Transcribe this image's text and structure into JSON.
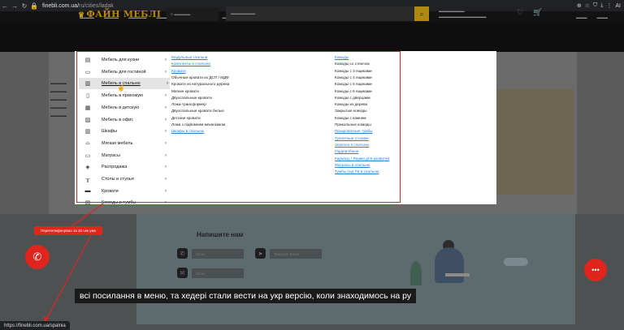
{
  "browser": {
    "url_host": "finebli.com.ua/",
    "url_path": "ru/cities/ladak",
    "right_label": "AI"
  },
  "mega_menu": {
    "categories": [
      {
        "label": "Мебель для кухни",
        "icon": "kitchen-icon"
      },
      {
        "label": "Мебель для гостиной",
        "icon": "living-room-icon"
      },
      {
        "label": "Мебель в спальню",
        "icon": "bedroom-icon"
      },
      {
        "label": "Мебель в прихожую",
        "icon": "hallway-icon"
      },
      {
        "label": "Мебель в детскую",
        "icon": "kids-room-icon"
      },
      {
        "label": "Мебель в офис",
        "icon": "office-icon"
      },
      {
        "label": "Шкафы",
        "icon": "wardrobe-icon"
      },
      {
        "label": "Мягкая мебель",
        "icon": "sofa-icon"
      },
      {
        "label": "Матрасы",
        "icon": "mattress-icon"
      },
      {
        "label": "Распродажа",
        "icon": "sale-icon"
      },
      {
        "label": "Столы и стулья",
        "icon": "table-icon"
      },
      {
        "label": "Кровати",
        "icon": "bed-icon"
      },
      {
        "label": "Комоды и тумбы",
        "icon": "dresser-icon"
      }
    ],
    "col1": [
      {
        "label": "Модульные спальни",
        "style": "blue"
      },
      {
        "label": "Комплекты в спальню",
        "style": "blue"
      },
      {
        "label": "Кровати",
        "style": "blue"
      },
      {
        "label": "Обычные кровати из ДСП / МДФ",
        "style": "black"
      },
      {
        "label": "Кровати из натурального дерева",
        "style": "black"
      },
      {
        "label": "Мягкие кровати",
        "style": "black"
      },
      {
        "label": "Двухспальные кровати",
        "style": "black"
      },
      {
        "label": "Ложа-трансформер",
        "style": "black"
      },
      {
        "label": "Двухспальные кровати белые",
        "style": "black"
      },
      {
        "label": "Детские кровати",
        "style": "black"
      },
      {
        "label": "Ложа з підйомним механізмом",
        "style": "black"
      },
      {
        "label": "Шкафы в спальню",
        "style": "blue"
      }
    ],
    "col2": [
      {
        "label": "Комоды",
        "style": "blue"
      },
      {
        "label": "Комоды со стеклом",
        "style": "black"
      },
      {
        "label": "Комоды с 3 ящиками",
        "style": "black"
      },
      {
        "label": "Комоды с 4 ящиками",
        "style": "black"
      },
      {
        "label": "Комоды с 5 ящиками",
        "style": "black"
      },
      {
        "label": "Комоды с 6 ящиками",
        "style": "black"
      },
      {
        "label": "Комоды с дверцами",
        "style": "black"
      },
      {
        "label": "Комоды из дерева",
        "style": "black"
      },
      {
        "label": "Закрытые комоды",
        "style": "black"
      },
      {
        "label": "Комоды с камнем",
        "style": "black"
      },
      {
        "label": "Прикольные комоды",
        "style": "black"
      },
      {
        "label": "Прикроватные тумбы",
        "style": "blue"
      },
      {
        "label": "Туалетные столики",
        "style": "blue"
      },
      {
        "label": "Зеркала в спальню",
        "style": "blue"
      },
      {
        "label": "Гардеробные",
        "style": "blue"
      },
      {
        "label": "Каркасы / Ящики для кроватей",
        "style": "blue"
      },
      {
        "label": "Матрасы в спальню",
        "style": "blue"
      },
      {
        "label": "Тумбы под ТВ в спальню",
        "style": "blue"
      }
    ]
  },
  "contact": {
    "title": "Напишите нам",
    "field_name": "Email",
    "field_tg": "Telegram Email",
    "field_mail": "Email"
  },
  "callback_bubble": "Перетелефонуємо за 30 сек уже",
  "subtitle": "всі посилання в меню, та хедері стали вести на укр версію, коли знаходимось на ру",
  "status_url": "https://finebli.com.ua/spalnia",
  "colors": {
    "accent_red": "#e0251e",
    "link_blue": "#2b7fd1",
    "brand_gold": "#b8860b"
  }
}
